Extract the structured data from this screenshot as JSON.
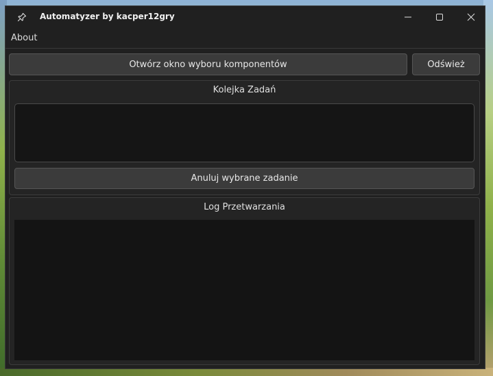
{
  "window": {
    "title": "Automatyzer by kacper12gry",
    "icons": {
      "pin": "pin-icon",
      "minimize": "minimize-icon",
      "maximize": "maximize-icon",
      "close": "close-icon"
    }
  },
  "menubar": {
    "items": [
      {
        "label": "About"
      }
    ]
  },
  "toolbar": {
    "open_selector_label": "Otwórz okno wyboru komponentów",
    "refresh_label": "Odśwież"
  },
  "queue": {
    "title": "Kolejka Zadań",
    "items": [],
    "cancel_label": "Anuluj wybrane zadanie"
  },
  "log": {
    "title": "Log Przetwarzania",
    "lines": []
  },
  "colors": {
    "window_bg": "#202020",
    "panel_bg": "#242424",
    "button_bg": "#3b3b3b",
    "text": "#e8e8e8",
    "list_bg": "#151515"
  }
}
